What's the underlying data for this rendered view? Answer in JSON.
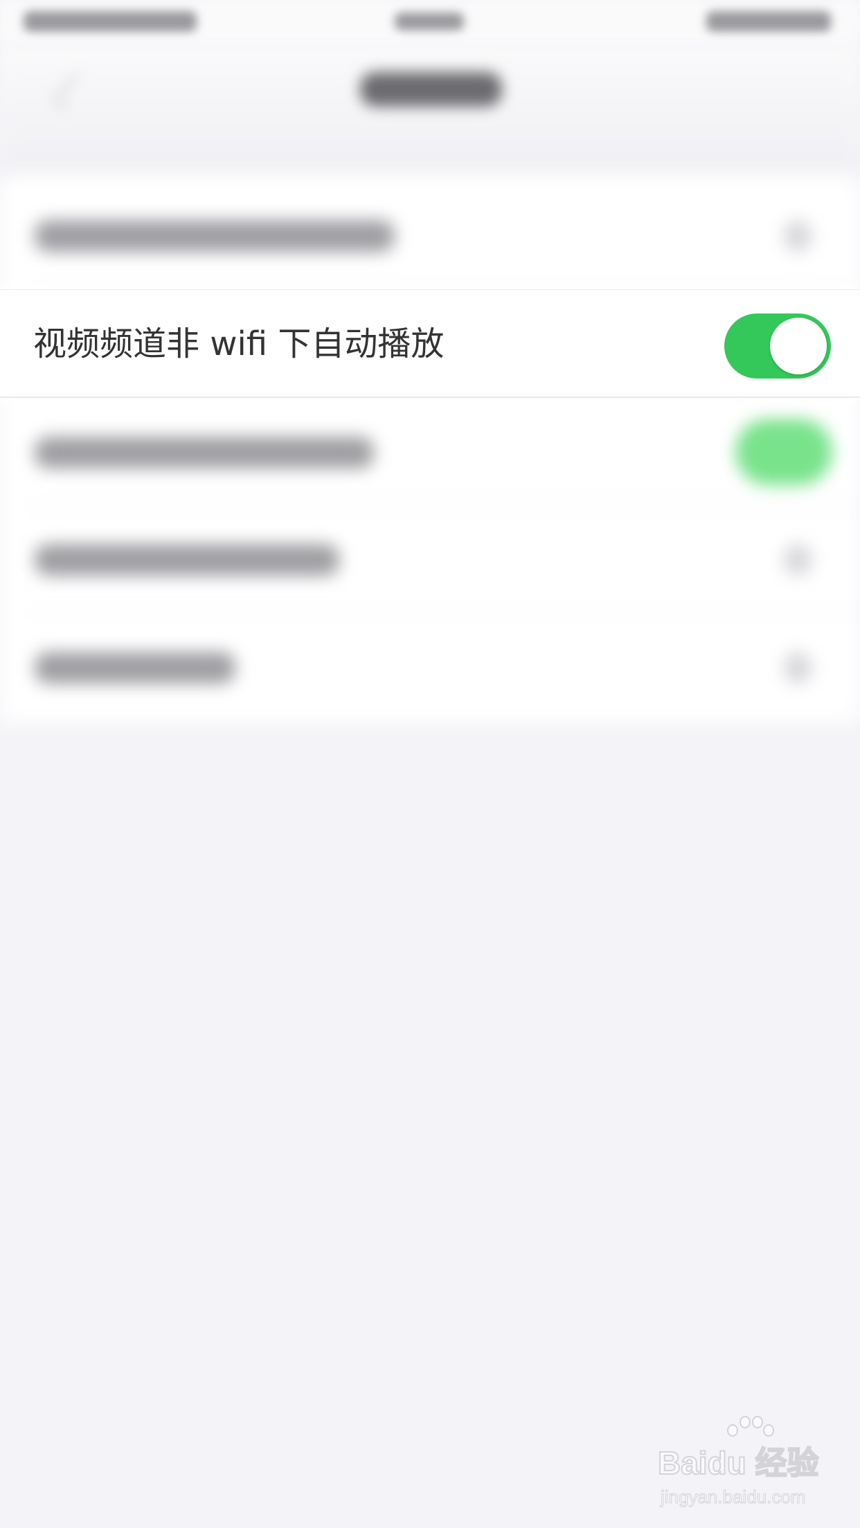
{
  "settings": {
    "focused_row": {
      "label": "视频频道非 wifi 下自动播放",
      "toggle_on": true
    }
  },
  "watermark": {
    "logo": "Baidu 经验",
    "url": "jingyan.baidu.com"
  },
  "colors": {
    "toggle_on": "#34c759",
    "background": "#f4f4f8",
    "row_background": "#ffffff",
    "label_text": "#333333"
  },
  "icons": [
    "back-chevron-icon",
    "chevron-right-icon",
    "toggle-switch",
    "baidu-paw-icon"
  ]
}
